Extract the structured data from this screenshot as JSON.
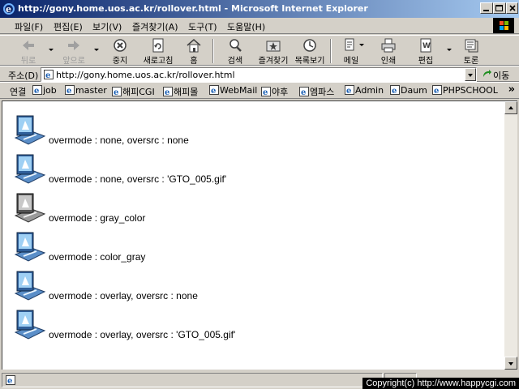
{
  "window": {
    "title": "http://gony.home.uos.ac.kr/rollover.html - Microsoft Internet Explorer"
  },
  "menu": {
    "items": [
      "파일(F)",
      "편집(E)",
      "보기(V)",
      "즐겨찾기(A)",
      "도구(T)",
      "도움말(H)"
    ]
  },
  "toolbar": {
    "buttons": [
      {
        "label": "뒤로",
        "icon": "back-arrow-icon",
        "enabled": false
      },
      {
        "label": "앞으로",
        "icon": "forward-arrow-icon",
        "enabled": false
      },
      {
        "label": "중지",
        "icon": "stop-icon",
        "enabled": true
      },
      {
        "label": "새로고침",
        "icon": "refresh-icon",
        "enabled": true
      },
      {
        "label": "홈",
        "icon": "home-icon",
        "enabled": true
      },
      {
        "label": "검색",
        "icon": "search-icon",
        "enabled": true
      },
      {
        "label": "즐겨찾기",
        "icon": "favorites-icon",
        "enabled": true
      },
      {
        "label": "목록보기",
        "icon": "history-icon",
        "enabled": true
      },
      {
        "label": "메일",
        "icon": "mail-icon",
        "enabled": true
      },
      {
        "label": "인쇄",
        "icon": "print-icon",
        "enabled": true
      },
      {
        "label": "편집",
        "icon": "edit-icon",
        "enabled": true
      },
      {
        "label": "토론",
        "icon": "discuss-icon",
        "enabled": true
      }
    ]
  },
  "address": {
    "label": "주소(D)",
    "url": "http://gony.home.uos.ac.kr/rollover.html",
    "go_label": "이동"
  },
  "links": {
    "label": "연결",
    "items": [
      "job",
      "master",
      "해피CGI",
      "해피몰",
      "WebMail",
      "야후",
      "엠파스",
      "Admin",
      "Daum",
      "PHPSCHOOL"
    ]
  },
  "content": {
    "rows": [
      {
        "text": "overmode : none, oversrc : none",
        "variant": "color"
      },
      {
        "text": "overmode : none, oversrc : 'GTO_005.gif'",
        "variant": "color"
      },
      {
        "text": "overmode : gray_color",
        "variant": "gray"
      },
      {
        "text": "overmode : color_gray",
        "variant": "color"
      },
      {
        "text": "overmode : overlay, oversrc : none",
        "variant": "color"
      },
      {
        "text": "overmode : overlay, oversrc : 'GTO_005.gif'",
        "variant": "color"
      }
    ]
  },
  "status": {
    "copyright": "Copyright(c) http://www.happycgi.com"
  },
  "colors": {
    "titlebar_start": "#0a246a",
    "titlebar_end": "#a6caf0",
    "chrome": "#d4d0c8",
    "content_bg": "#ffffff"
  }
}
